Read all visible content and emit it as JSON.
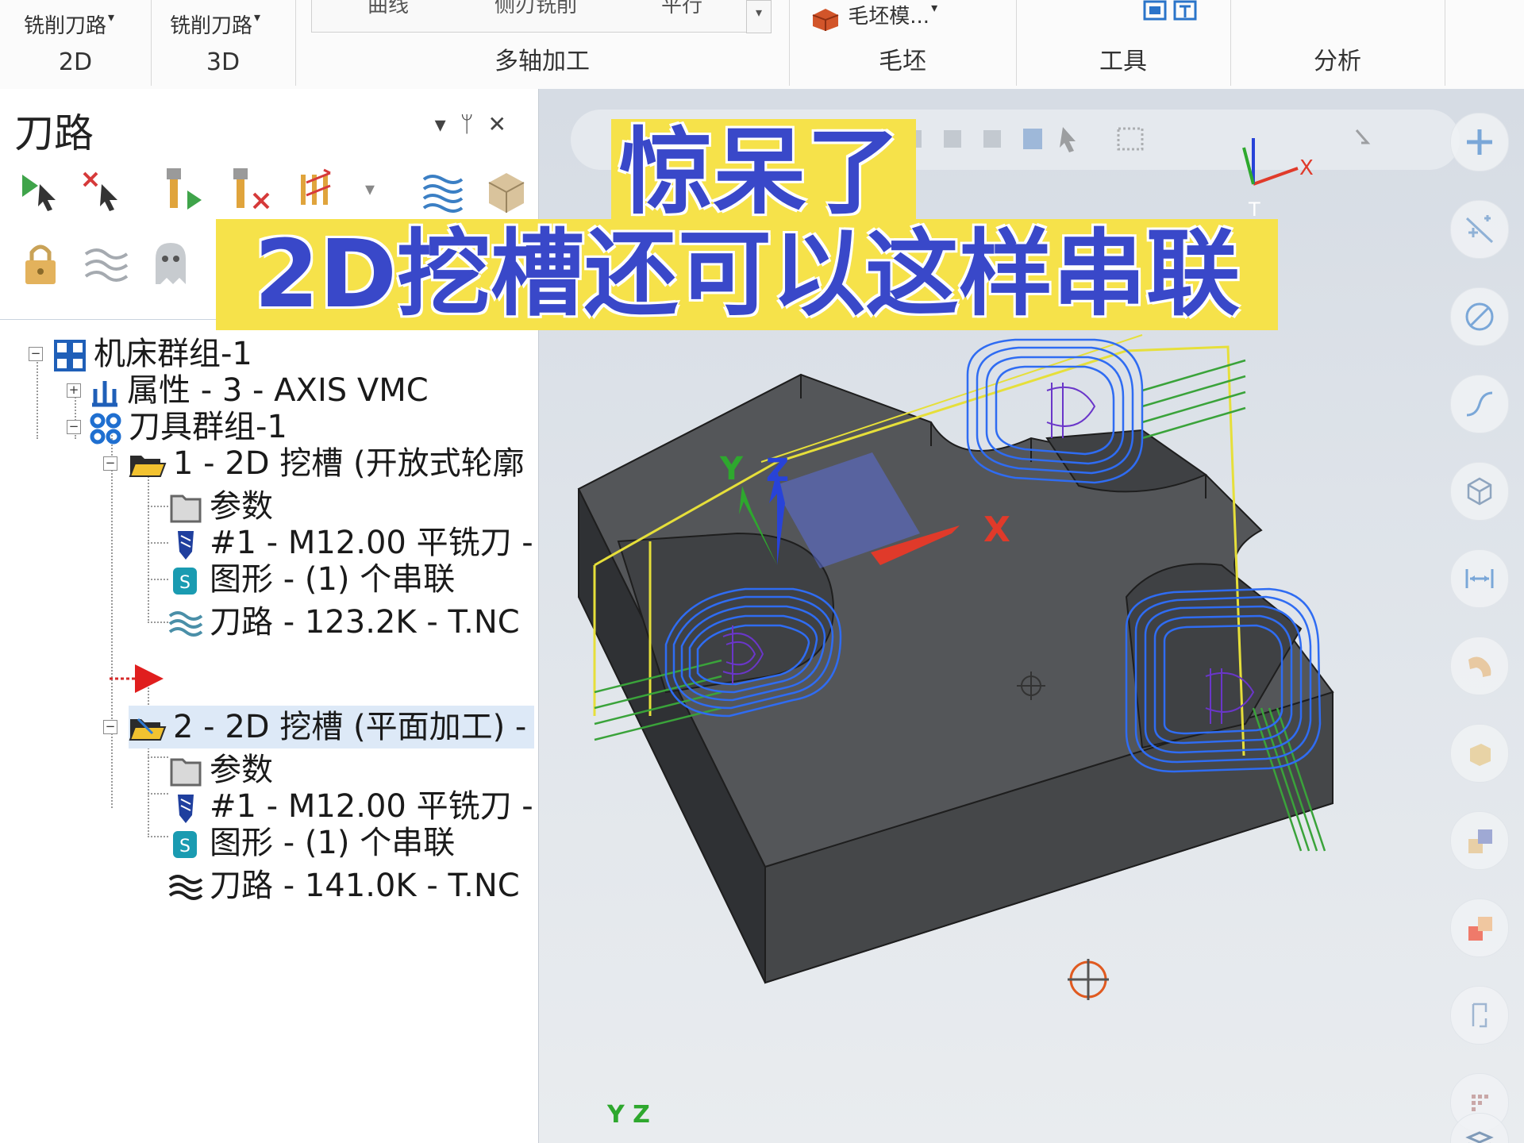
{
  "ribbon": {
    "groups": [
      {
        "label": "2D",
        "button": "铣削刀路"
      },
      {
        "label": "3D",
        "button": "铣削刀路"
      },
      {
        "label": "多轴加工",
        "items": [
          "曲线",
          "侧刃铣削",
          "平行"
        ]
      },
      {
        "label": "毛坯",
        "button": "毛坯模..."
      },
      {
        "label": "工具"
      },
      {
        "label": "分析"
      }
    ]
  },
  "panel": {
    "title": "刀路",
    "controls": [
      "▾",
      "ᛘ",
      "✕"
    ]
  },
  "tree": [
    {
      "text": "机床群组-1"
    },
    {
      "text": "属性 - 3 - AXIS VMC"
    },
    {
      "text": "刀具群组-1"
    },
    {
      "text": "1 - 2D 挖槽 (开放式轮廓"
    },
    {
      "text": "参数"
    },
    {
      "text": "#1 - M12.00 平铣刀 -"
    },
    {
      "text": "图形 - (1) 个串联"
    },
    {
      "text": "刀路 - 123.2K - T.NC"
    },
    {
      "text": "2 - 2D 挖槽 (平面加工) -"
    },
    {
      "text": "参数"
    },
    {
      "text": "#1 - M12.00 平铣刀 -"
    },
    {
      "text": "图形 - (1) 个串联"
    },
    {
      "text": "刀路 - 141.0K - T.NC"
    }
  ],
  "banner": {
    "line1": "惊呆了",
    "line2": "2D挖槽还可以这样串联"
  },
  "viewport": {
    "axis_x": "X",
    "axis_y": "Y",
    "axis_z": "Z",
    "gnomon_t": "T",
    "bottom_axes": "Y Z"
  },
  "colors": {
    "banner_bg": "#f6e24a",
    "banner_text": "#3948c9",
    "toolpath_blue": "#2f6cf2",
    "toolpath_purple": "#6a36c9",
    "lead_green": "#3aa33a",
    "rapid_yellow": "#e6df3a",
    "part_gray": "#4b4d50"
  }
}
